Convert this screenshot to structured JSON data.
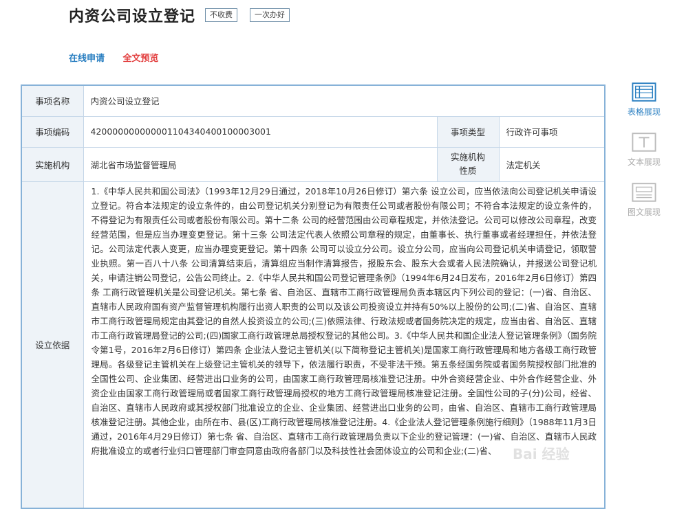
{
  "header": {
    "title": "内资公司设立登记",
    "badge_free": "不收费",
    "badge_once": "一次办好"
  },
  "links": {
    "apply": "在线申请",
    "preview": "全文预览"
  },
  "table": {
    "name_label": "事项名称",
    "name_value": "内资公司设立登记",
    "code_label": "事项编码",
    "code_value": "420000000000001104340400100003001",
    "type_label": "事项类型",
    "type_value": "行政许可事项",
    "org_label": "实施机构",
    "org_value": "湖北省市场监督管理局",
    "org_nature_label": "实施机构性质",
    "org_nature_value": "法定机关",
    "basis_label": "设立依据",
    "basis_text": "1.《中华人民共和国公司法》（1993年12月29日通过，2018年10月26日修订）第六条 设立公司，应当依法向公司登记机关申请设立登记。符合本法规定的设立条件的，由公司登记机关分别登记为有限责任公司或者股份有限公司；不符合本法规定的设立条件的，不得登记为有限责任公司或者股份有限公司。第十二条 公司的经营范围由公司章程规定，并依法登记。公司可以修改公司章程，改变经营范围，但是应当办理变更登记。第十三条 公司法定代表人依照公司章程的规定，由董事长、执行董事或者经理担任，并依法登记。公司法定代表人变更，应当办理变更登记。第十四条 公司可以设立分公司。设立分公司，应当向公司登记机关申请登记，领取营业执照。第一百八十八条 公司清算结束后，清算组应当制作清算报告，报股东会、股东大会或者人民法院确认，并报送公司登记机关，申请注销公司登记，公告公司终止。2.《中华人民共和国公司登记管理条例》（1994年6月24日发布，2016年2月6日修订）第四条 工商行政管理机关是公司登记机关。第七条 省、自治区、直辖市工商行政管理局负责本辖区内下列公司的登记：(一)省、自治区、直辖市人民政府国有资产监督管理机构履行出资人职责的公司以及该公司投资设立并持有50%以上股份的公司;(二)省、自治区、直辖市工商行政管理局规定由其登记的自然人投资设立的公司;(三)依照法律、行政法规或者国务院决定的规定，应当由省、自治区、直辖市工商行政管理局登记的公司;(四)国家工商行政管理总局授权登记的其他公司。3.《中华人民共和国企业法人登记管理条例》（国务院令第1号，2016年2月6日修订）第四条 企业法人登记主管机关(以下简称登记主管机关)是国家工商行政管理局和地方各级工商行政管理局。各级登记主管机关在上级登记主管机关的领导下，依法履行职责，不受非法干预。第五条经国务院或者国务院授权部门批准的全国性公司、企业集团、经营进出口业务的公司，由国家工商行政管理局核准登记注册。中外合资经营企业、中外合作经营企业、外资企业由国家工商行政管理局或者国家工商行政管理局授权的地方工商行政管理局核准登记注册。全国性公司的子(分)公司，经省、自治区、直辖市人民政府或其授权部门批准设立的企业、企业集团、经营进出口业务的公司，由省、自治区、直辖市工商行政管理局核准登记注册。其他企业，由所在市、县(区)工商行政管理局核准登记注册。4.《企业法人登记管理条例施行细则》（1988年11月3日通过，2016年4月29日修订）第七条 省、自治区、直辖市工商行政管理局负责以下企业的登记管理：(一)省、自治区、直辖市人民政府批准设立的或者行业归口管理部门审查同意由政府各部门以及科技性社会团体设立的公司和企业;(二)省、"
  },
  "side": {
    "table_view": "表格展现",
    "text_view": "文本展现",
    "image_view": "图文展现"
  },
  "watermark": "Bai 经验"
}
